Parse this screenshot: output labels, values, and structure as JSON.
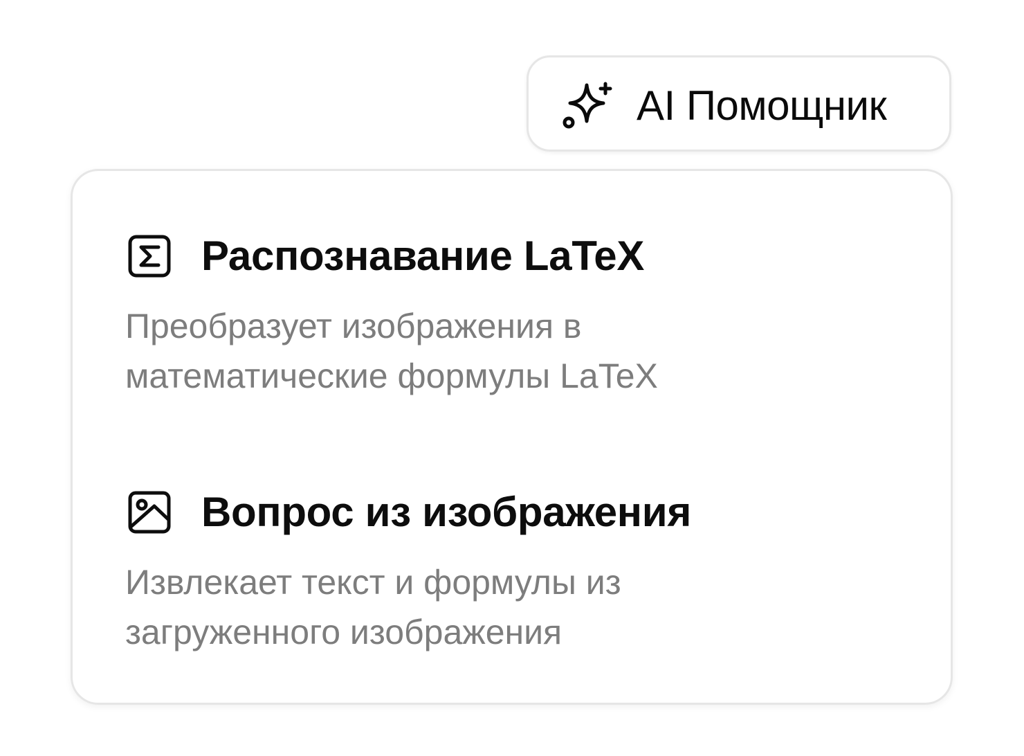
{
  "ai_button": {
    "label": "AI Помощник",
    "icon": "sparkles-icon"
  },
  "menu": {
    "items": [
      {
        "icon": "sigma-square-icon",
        "title": "Распознавание LaTeX",
        "description_lines": [
          "Преобразует изображения в",
          "математические формулы LaTeX"
        ]
      },
      {
        "icon": "image-icon",
        "title": "Вопрос из изображения",
        "description_lines": [
          "Извлекает текст и формулы из",
          "загруженного изображения"
        ]
      }
    ]
  },
  "colors": {
    "title_text": "#0d0d0d",
    "description_text": "#7d7d7d",
    "border": "#e6e6e6",
    "background": "#ffffff"
  }
}
